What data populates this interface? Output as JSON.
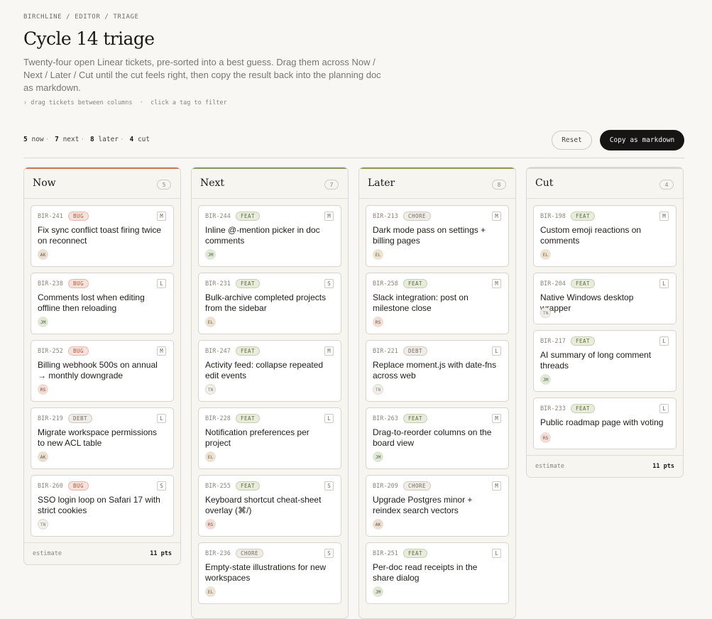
{
  "breadcrumb": "BIRCHLINE / EDITOR / TRIAGE",
  "title": "Cycle 14 triage",
  "description": "Twenty-four open Linear tickets, pre-sorted into a best guess. Drag them across Now / Next / Later / Cut until the cut feels right, then copy the result back into the planning doc as markdown.",
  "hint": "› drag tickets between columns  ·  click a tag to filter",
  "counts": {
    "now_n": "5",
    "now_label": "now",
    "next_n": "7",
    "next_label": "next",
    "later_n": "8",
    "later_label": "later",
    "cut_n": "4",
    "cut_label": "cut"
  },
  "actions": {
    "reset": "Reset",
    "copy": "Copy as markdown"
  },
  "colors": {
    "now": "#c97b5f",
    "next": "#8c9a6a",
    "later": "#9a9a5a",
    "cut": "#dcd8d1"
  },
  "columns": [
    {
      "name": "Now",
      "count": "5",
      "estimate_label": "estimate",
      "estimate": "11 pts",
      "cards": [
        {
          "id": "BIR-241",
          "tag": "BUG",
          "size": "M",
          "title": "Fix sync conflict toast firing twice on reconnect",
          "avatar": "AK"
        },
        {
          "id": "BIR-238",
          "tag": "BUG",
          "size": "L",
          "title": "Comments lost when editing offline then reloading",
          "avatar": "JM"
        },
        {
          "id": "BIR-252",
          "tag": "BUG",
          "size": "M",
          "title": "Billing webhook 500s on annual → monthly downgrade",
          "avatar": "RS"
        },
        {
          "id": "BIR-219",
          "tag": "DEBT",
          "size": "L",
          "title": "Migrate workspace permissions to new ACL table",
          "avatar": "AK"
        },
        {
          "id": "BIR-260",
          "tag": "BUG",
          "size": "S",
          "title": "SSO login loop on Safari 17 with strict cookies",
          "avatar": "TN"
        }
      ]
    },
    {
      "name": "Next",
      "count": "7",
      "cards": [
        {
          "id": "BIR-244",
          "tag": "FEAT",
          "size": "M",
          "title": "Inline @-mention picker in doc comments",
          "avatar": "JM"
        },
        {
          "id": "BIR-231",
          "tag": "FEAT",
          "size": "S",
          "title": "Bulk-archive completed projects from the sidebar",
          "avatar": "EL"
        },
        {
          "id": "BIR-247",
          "tag": "FEAT",
          "size": "M",
          "title": "Activity feed: collapse repeated edit events",
          "avatar": "TN"
        },
        {
          "id": "BIR-228",
          "tag": "FEAT",
          "size": "L",
          "title": "Notification preferences per project",
          "avatar": "EL"
        },
        {
          "id": "BIR-255",
          "tag": "FEAT",
          "size": "S",
          "title": "Keyboard shortcut cheat-sheet overlay (⌘/)",
          "avatar": "RS"
        },
        {
          "id": "BIR-236",
          "tag": "CHORE",
          "size": "S",
          "title": "Empty-state illustrations for new workspaces",
          "avatar": "EL"
        }
      ]
    },
    {
      "name": "Later",
      "count": "8",
      "cards": [
        {
          "id": "BIR-213",
          "tag": "CHORE",
          "size": "M",
          "title": "Dark mode pass on settings + billing pages",
          "avatar": "EL"
        },
        {
          "id": "BIR-258",
          "tag": "FEAT",
          "size": "M",
          "title": "Slack integration: post on milestone close",
          "avatar": "RS"
        },
        {
          "id": "BIR-221",
          "tag": "DEBT",
          "size": "L",
          "title": "Replace moment.js with date-fns across web",
          "avatar": "TN"
        },
        {
          "id": "BIR-263",
          "tag": "FEAT",
          "size": "M",
          "title": "Drag-to-reorder columns on the board view",
          "avatar": "JM"
        },
        {
          "id": "BIR-209",
          "tag": "CHORE",
          "size": "M",
          "title": "Upgrade Postgres minor + reindex search vectors",
          "avatar": "AK"
        },
        {
          "id": "BIR-251",
          "tag": "FEAT",
          "size": "L",
          "title": "Per-doc read receipts in the share dialog",
          "avatar": "JM"
        }
      ]
    },
    {
      "name": "Cut",
      "count": "4",
      "estimate_label": "estimate",
      "estimate": "11 pts",
      "cards": [
        {
          "id": "BIR-198",
          "tag": "FEAT",
          "size": "M",
          "title": "Custom emoji reactions on comments",
          "avatar": "EL"
        },
        {
          "id": "BIR-204",
          "tag": "FEAT",
          "size": "L",
          "title": "Native Windows desktop wrapper",
          "avatar": "TN"
        },
        {
          "id": "BIR-217",
          "tag": "FEAT",
          "size": "L",
          "title": "AI summary of long comment threads",
          "avatar": "JM"
        },
        {
          "id": "BIR-233",
          "tag": "FEAT",
          "size": "L",
          "title": "Public roadmap page with voting",
          "avatar": "RS"
        }
      ]
    }
  ]
}
